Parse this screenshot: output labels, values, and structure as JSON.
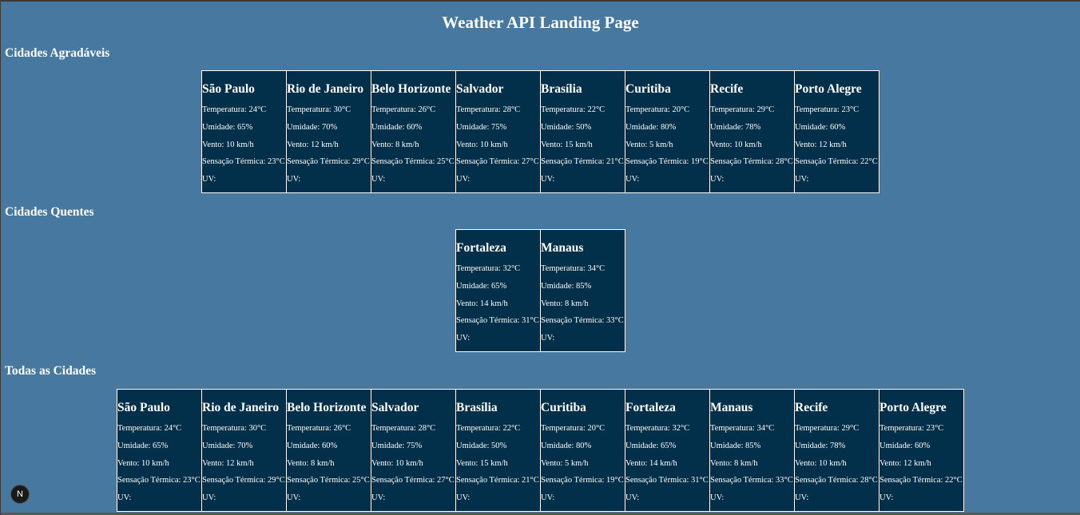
{
  "page": {
    "title": "Weather API Landing Page"
  },
  "sections": {
    "pleasant": {
      "heading": "Cidades Agradáveis",
      "cities": [
        {
          "name": "São Paulo",
          "temperature": "Temperatura: 24°C",
          "humidity": "Umidade: 65%",
          "wind": "Vento: 10 km/h",
          "feels_like": "Sensação Térmica: 23°C",
          "uv": "UV:"
        },
        {
          "name": "Rio de Janeiro",
          "temperature": "Temperatura: 30°C",
          "humidity": "Umidade: 70%",
          "wind": "Vento: 12 km/h",
          "feels_like": "Sensação Térmica: 29°C",
          "uv": "UV:"
        },
        {
          "name": "Belo Horizonte",
          "temperature": "Temperatura: 26°C",
          "humidity": "Umidade: 60%",
          "wind": "Vento: 8 km/h",
          "feels_like": "Sensação Térmica: 25°C",
          "uv": "UV:"
        },
        {
          "name": "Salvador",
          "temperature": "Temperatura: 28°C",
          "humidity": "Umidade: 75%",
          "wind": "Vento: 10 km/h",
          "feels_like": "Sensação Térmica: 27°C",
          "uv": "UV:"
        },
        {
          "name": "Brasília",
          "temperature": "Temperatura: 22°C",
          "humidity": "Umidade: 50%",
          "wind": "Vento: 15 km/h",
          "feels_like": "Sensação Térmica: 21°C",
          "uv": "UV:"
        },
        {
          "name": "Curitiba",
          "temperature": "Temperatura: 20°C",
          "humidity": "Umidade: 80%",
          "wind": "Vento: 5 km/h",
          "feels_like": "Sensação Térmica: 19°C",
          "uv": "UV:"
        },
        {
          "name": "Recife",
          "temperature": "Temperatura: 29°C",
          "humidity": "Umidade: 78%",
          "wind": "Vento: 10 km/h",
          "feels_like": "Sensação Térmica: 28°C",
          "uv": "UV:"
        },
        {
          "name": "Porto Alegre",
          "temperature": "Temperatura: 23°C",
          "humidity": "Umidade: 60%",
          "wind": "Vento: 12 km/h",
          "feels_like": "Sensação Térmica: 22°C",
          "uv": "UV:"
        }
      ]
    },
    "hot": {
      "heading": "Cidades Quentes",
      "cities": [
        {
          "name": "Fortaleza",
          "temperature": "Temperatura: 32°C",
          "humidity": "Umidade: 65%",
          "wind": "Vento: 14 km/h",
          "feels_like": "Sensação Térmica: 31°C",
          "uv": "UV:"
        },
        {
          "name": "Manaus",
          "temperature": "Temperatura: 34°C",
          "humidity": "Umidade: 85%",
          "wind": "Vento: 8 km/h",
          "feels_like": "Sensação Térmica: 33°C",
          "uv": "UV:"
        }
      ]
    },
    "all": {
      "heading": "Todas as Cidades",
      "cities": [
        {
          "name": "São Paulo",
          "temperature": "Temperatura: 24°C",
          "humidity": "Umidade: 65%",
          "wind": "Vento: 10 km/h",
          "feels_like": "Sensação Térmica: 23°C",
          "uv": "UV:"
        },
        {
          "name": "Rio de Janeiro",
          "temperature": "Temperatura: 30°C",
          "humidity": "Umidade: 70%",
          "wind": "Vento: 12 km/h",
          "feels_like": "Sensação Térmica: 29°C",
          "uv": "UV:"
        },
        {
          "name": "Belo Horizonte",
          "temperature": "Temperatura: 26°C",
          "humidity": "Umidade: 60%",
          "wind": "Vento: 8 km/h",
          "feels_like": "Sensação Térmica: 25°C",
          "uv": "UV:"
        },
        {
          "name": "Salvador",
          "temperature": "Temperatura: 28°C",
          "humidity": "Umidade: 75%",
          "wind": "Vento: 10 km/h",
          "feels_like": "Sensação Térmica: 27°C",
          "uv": "UV:"
        },
        {
          "name": "Brasília",
          "temperature": "Temperatura: 22°C",
          "humidity": "Umidade: 50%",
          "wind": "Vento: 15 km/h",
          "feels_like": "Sensação Térmica: 21°C",
          "uv": "UV:"
        },
        {
          "name": "Curitiba",
          "temperature": "Temperatura: 20°C",
          "humidity": "Umidade: 80%",
          "wind": "Vento: 5 km/h",
          "feels_like": "Sensação Térmica: 19°C",
          "uv": "UV:"
        },
        {
          "name": "Fortaleza",
          "temperature": "Temperatura: 32°C",
          "humidity": "Umidade: 65%",
          "wind": "Vento: 14 km/h",
          "feels_like": "Sensação Térmica: 31°C",
          "uv": "UV:"
        },
        {
          "name": "Manaus",
          "temperature": "Temperatura: 34°C",
          "humidity": "Umidade: 85%",
          "wind": "Vento: 8 km/h",
          "feels_like": "Sensação Térmica: 33°C",
          "uv": "UV:"
        },
        {
          "name": "Recife",
          "temperature": "Temperatura: 29°C",
          "humidity": "Umidade: 78%",
          "wind": "Vento: 10 km/h",
          "feels_like": "Sensação Térmica: 28°C",
          "uv": "UV:"
        },
        {
          "name": "Porto Alegre",
          "temperature": "Temperatura: 23°C",
          "humidity": "Umidade: 60%",
          "wind": "Vento: 12 km/h",
          "feels_like": "Sensação Térmica: 22°C",
          "uv": "UV:"
        }
      ]
    }
  },
  "dev_badge": {
    "label": "N",
    "icon": "nextjs-logo-icon"
  },
  "colors": {
    "background": "#4779a0",
    "card_background": "#02304a",
    "card_border": "#ffffff",
    "text": "#ffffff"
  }
}
